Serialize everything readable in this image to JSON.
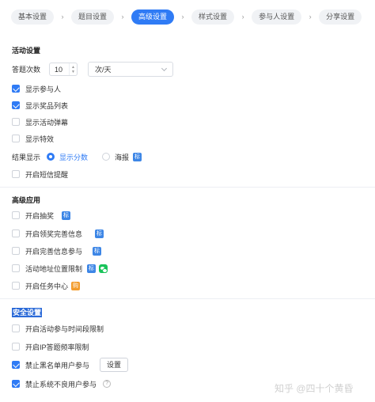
{
  "steps": [
    {
      "label": "基本设置",
      "active": false
    },
    {
      "label": "题目设置",
      "active": false
    },
    {
      "label": "高级设置",
      "active": true
    },
    {
      "label": "样式设置",
      "active": false
    },
    {
      "label": "参与人设置",
      "active": false
    },
    {
      "label": "分享设置",
      "active": false
    }
  ],
  "activity": {
    "title": "活动设置",
    "answer_count_label": "答题次数",
    "answer_count_value": "10",
    "period_value": "次/天",
    "options": [
      {
        "label": "显示参与人",
        "checked": true
      },
      {
        "label": "显示奖品列表",
        "checked": true
      },
      {
        "label": "显示活动弹幕",
        "checked": false
      },
      {
        "label": "显示特效",
        "checked": false
      }
    ],
    "result_label": "结果显示",
    "result_options": [
      {
        "label": "显示分数",
        "checked": true
      },
      {
        "label": "海报",
        "checked": false
      }
    ],
    "result_badge": "标",
    "sms_label": "开启短信提醒"
  },
  "advanced": {
    "title": "高级应用",
    "items": [
      {
        "label": "开启抽奖",
        "badges": [
          "标"
        ]
      },
      {
        "label": "开启领奖完善信息",
        "badges": [
          "标"
        ]
      },
      {
        "label": "开启完善信息参与",
        "badges": [
          "标"
        ]
      },
      {
        "label": "活动地址位置限制",
        "badges": [
          "标"
        ]
      },
      {
        "label": "开启任务中心",
        "badges": [
          "购"
        ]
      }
    ]
  },
  "security": {
    "title": "安全设置",
    "items": [
      {
        "label": "开启活动参与时间段限制",
        "checked": false
      },
      {
        "label": "开启IP答题频率限制",
        "checked": false
      },
      {
        "label": "禁止黑名单用户参与",
        "checked": true
      },
      {
        "label": "禁止系统不良用户参与",
        "checked": true
      }
    ],
    "settings_button": "设置"
  },
  "watermark": "知乎 @四十个黄昏",
  "colors": {
    "accent": "#2f7bf5",
    "badge_blue": "#3d86e6",
    "badge_orange": "#f39c2c",
    "badge_green": "#19c35a"
  }
}
